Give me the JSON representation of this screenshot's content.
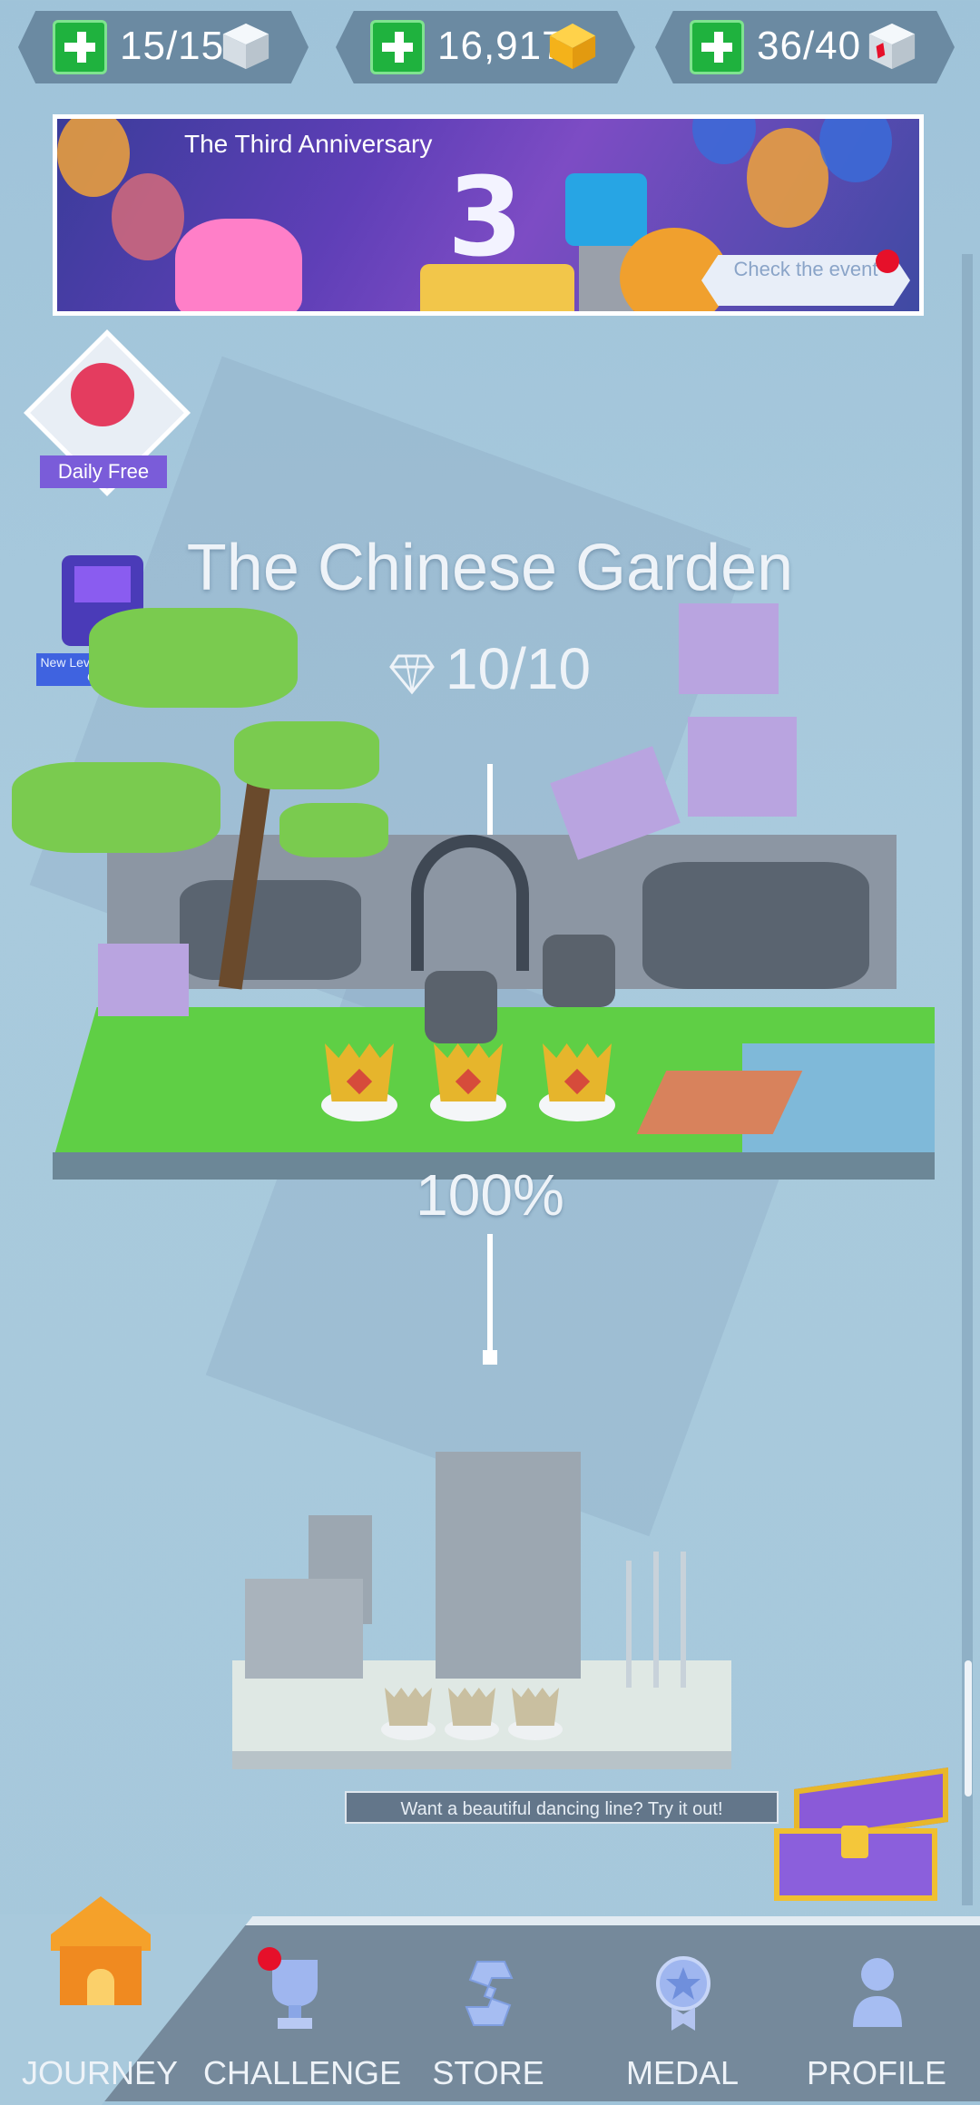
{
  "resources": {
    "lives": "15/15",
    "gems": "16,917",
    "cubes": "36/40"
  },
  "banner": {
    "title": "The Third Anniversary",
    "number": "3",
    "cta": "Check the event"
  },
  "side": {
    "daily_free": "Daily Free",
    "new_level": "New Level - The Video Game"
  },
  "level": {
    "name": "The Chinese Garden",
    "gems": "10/10",
    "completion": "100%"
  },
  "tip": "Want a beautiful dancing line? Try it out!",
  "nav": {
    "journey": "JOURNEY",
    "challenge": "CHALLENGE",
    "store": "STORE",
    "medal": "MEDAL",
    "profile": "PROFILE"
  },
  "colors": {
    "plus_green": "#1fb23e",
    "nav_bg": "#75899b",
    "notify_red": "#e6102a"
  }
}
